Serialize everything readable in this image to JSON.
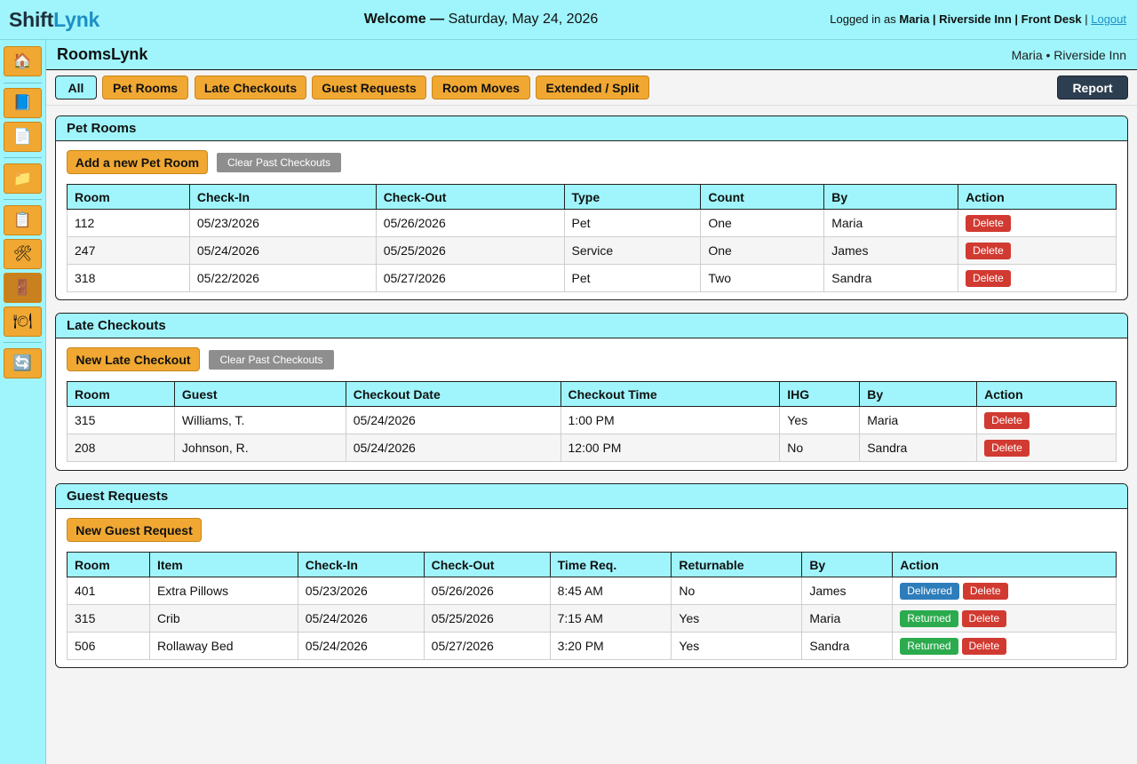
{
  "header": {
    "logo_part1": "Shift",
    "logo_part2": "Lynk",
    "welcome_label": "Welcome —",
    "date": "Saturday, May 24, 2026",
    "login_prefix": "Logged in as",
    "login_details": "Maria | Riverside Inn | Front Desk",
    "login_sep": "|",
    "logout_label": "Logout"
  },
  "sidebar": {
    "items": [
      {
        "icon": "home-icon",
        "glyph": "🏠"
      },
      {
        "icon": "book-icon",
        "glyph": "📘"
      },
      {
        "icon": "document-icon",
        "glyph": "📄"
      },
      {
        "icon": "folder-icon",
        "glyph": "📁"
      },
      {
        "icon": "clipboard-icon",
        "glyph": "📋"
      },
      {
        "icon": "tools-icon",
        "glyph": "🛠"
      },
      {
        "icon": "door-icon",
        "glyph": "🚪"
      },
      {
        "icon": "plate-icon",
        "glyph": "🍽"
      },
      {
        "icon": "refresh-icon",
        "glyph": "🔄"
      }
    ]
  },
  "app": {
    "title": "RoomsLynk",
    "user": "Maria • Riverside Inn"
  },
  "filters": {
    "all": "All",
    "pet_rooms": "Pet Rooms",
    "late_checkouts": "Late Checkouts",
    "guest_requests": "Guest Requests",
    "room_moves": "Room Moves",
    "extended_split": "Extended / Split",
    "report": "Report"
  },
  "pet_rooms": {
    "title": "Pet Rooms",
    "add_label": "Add a new Pet Room",
    "clear_label": "Clear Past Checkouts",
    "columns": [
      "Room",
      "Check-In",
      "Check-Out",
      "Type",
      "Count",
      "By",
      "Action"
    ],
    "rows": [
      {
        "room": "112",
        "check_in": "05/23/2026",
        "check_out": "05/26/2026",
        "type": "Pet",
        "count": "One",
        "by": "Maria",
        "action": "Delete"
      },
      {
        "room": "247",
        "check_in": "05/24/2026",
        "check_out": "05/25/2026",
        "type": "Service",
        "count": "One",
        "by": "James",
        "action": "Delete"
      },
      {
        "room": "318",
        "check_in": "05/22/2026",
        "check_out": "05/27/2026",
        "type": "Pet",
        "count": "Two",
        "by": "Sandra",
        "action": "Delete"
      }
    ]
  },
  "late_checkouts": {
    "title": "Late Checkouts",
    "add_label": "New Late Checkout",
    "clear_label": "Clear Past Checkouts",
    "columns": [
      "Room",
      "Guest",
      "Checkout Date",
      "Checkout Time",
      "IHG",
      "By",
      "Action"
    ],
    "rows": [
      {
        "room": "315",
        "guest": "Williams, T.",
        "date": "05/24/2026",
        "time": "1:00 PM",
        "ihg": "Yes",
        "by": "Maria",
        "action": "Delete"
      },
      {
        "room": "208",
        "guest": "Johnson, R.",
        "date": "05/24/2026",
        "time": "12:00 PM",
        "ihg": "No",
        "by": "Sandra",
        "action": "Delete"
      }
    ]
  },
  "guest_requests": {
    "title": "Guest Requests",
    "add_label": "New Guest Request",
    "columns": [
      "Room",
      "Item",
      "Check-In",
      "Check-Out",
      "Time Req.",
      "Returnable",
      "By",
      "Action"
    ],
    "rows": [
      {
        "room": "401",
        "item": "Extra Pillows",
        "check_in": "05/23/2026",
        "check_out": "05/26/2026",
        "time": "8:45 AM",
        "returnable": "No",
        "by": "James",
        "status": "Delivered",
        "action": "Delete"
      },
      {
        "room": "315",
        "item": "Crib",
        "check_in": "05/24/2026",
        "check_out": "05/25/2026",
        "time": "7:15 AM",
        "returnable": "Yes",
        "by": "Maria",
        "status": "Returned",
        "action": "Delete"
      },
      {
        "room": "506",
        "item": "Rollaway Bed",
        "check_in": "05/24/2026",
        "check_out": "05/27/2026",
        "time": "3:20 PM",
        "returnable": "Yes",
        "by": "Sandra",
        "status": "Returned",
        "action": "Delete"
      }
    ]
  },
  "colors": {
    "cyan": "#9ff5fb",
    "orange": "#f0a832",
    "navy": "#2d3e50",
    "delete_red": "#d13a31",
    "delivered_blue": "#2e7dbb",
    "returned_green": "#2bab4d"
  }
}
